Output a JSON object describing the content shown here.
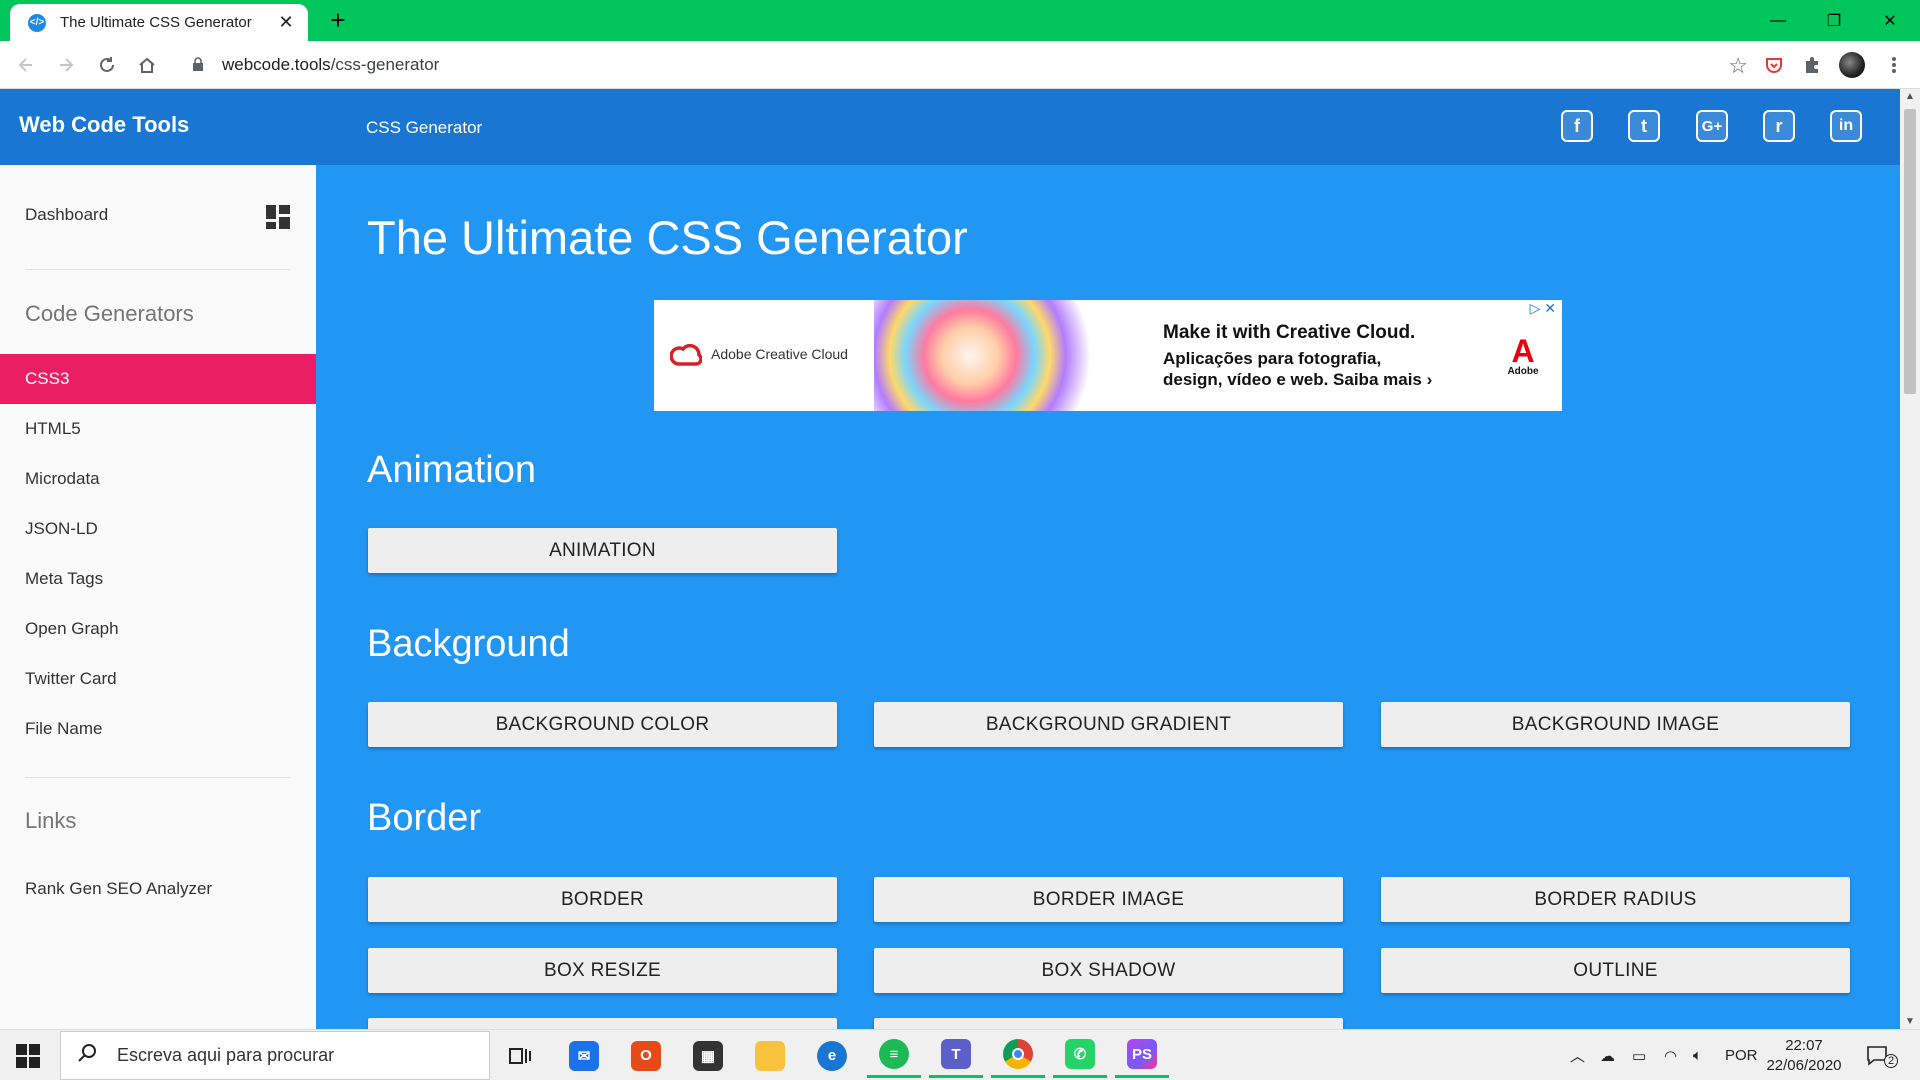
{
  "browser": {
    "tab_title": "The Ultimate CSS Generator",
    "tab_favicon": "</>",
    "tab_close": "✕",
    "new_tab": "+",
    "url_host": "webcode.tools",
    "url_path": "/css-generator",
    "window_minimize": "—",
    "window_restore": "❐",
    "window_close": "✕"
  },
  "header": {
    "brand": "Web Code Tools",
    "breadcrumb": "CSS Generator",
    "social": [
      {
        "icon": "facebook-icon",
        "glyph": "f"
      },
      {
        "icon": "twitter-icon",
        "glyph": "t"
      },
      {
        "icon": "google-plus-icon",
        "glyph": "G+"
      },
      {
        "icon": "reddit-icon",
        "glyph": "r"
      },
      {
        "icon": "linkedin-icon",
        "glyph": "in"
      }
    ]
  },
  "sidebar": {
    "dashboard": "Dashboard",
    "code_generators_heading": "Code Generators",
    "items": [
      "CSS3",
      "HTML5",
      "Microdata",
      "JSON-LD",
      "Meta Tags",
      "Open Graph",
      "Twitter Card",
      "File Name"
    ],
    "active_index": 0,
    "links_heading": "Links",
    "links": [
      "Rank Gen SEO Analyzer"
    ]
  },
  "main": {
    "title": "The Ultimate CSS Generator",
    "ad": {
      "brand": "Adobe Creative Cloud",
      "headline": "Make it with Creative Cloud.",
      "body_line1": "Aplicações para fotografia,",
      "body_line2": "design, vídeo e web. Saiba mais ›",
      "adobe_mark": "A",
      "adobe_text": "Adobe",
      "choices": "▷ ✕"
    },
    "sections": [
      {
        "heading": "Animation",
        "buttons": [
          "ANIMATION"
        ]
      },
      {
        "heading": "Background",
        "buttons": [
          "BACKGROUND COLOR",
          "BACKGROUND GRADIENT",
          "BACKGROUND IMAGE"
        ]
      },
      {
        "heading": "Border",
        "buttons": [
          "BORDER",
          "BORDER IMAGE",
          "BORDER RADIUS",
          "BOX RESIZE",
          "BOX SHADOW",
          "OUTLINE"
        ]
      }
    ]
  },
  "taskbar": {
    "search_placeholder": "Escreva aqui para procurar",
    "language": "POR",
    "time": "22:07",
    "date": "22/06/2020",
    "notification_count": "2"
  },
  "colors": {
    "tab_strip": "#00c65b",
    "header": "#1976d2",
    "main_bg": "#2196f3",
    "active_item": "#e91e63"
  }
}
